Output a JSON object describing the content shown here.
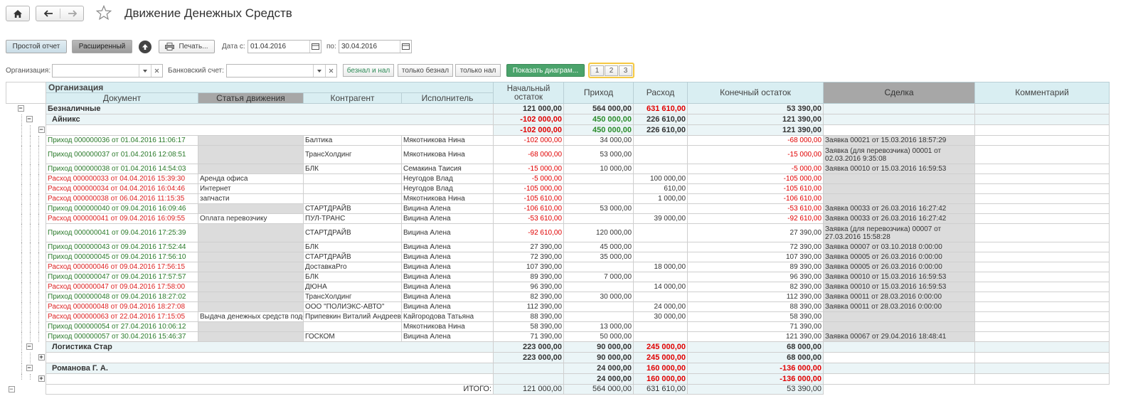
{
  "window": {
    "title": "Движение Денежных Средств"
  },
  "toolbar": {
    "simple_report": "Простой отчет",
    "extended": "Расширенный",
    "print": "Печать...",
    "date_from_label": "Дата с:",
    "date_from": "01.04.2016",
    "date_to_label": "по:",
    "date_to": "30.04.2016"
  },
  "filters": {
    "org_label": "Организация:",
    "org_value": "",
    "bank_label": "Банковский счет:",
    "bank_value": "",
    "payment_modes": [
      "безнал и нал",
      "только безнал",
      "только нал"
    ],
    "show_diagram": "Показать диаграм...",
    "pages": [
      "1",
      "2",
      "3"
    ]
  },
  "report": {
    "headers": {
      "org": "Организация",
      "doc": "Документ",
      "article": "Статья движения",
      "contragent": "Контрагент",
      "executor": "Исполнитель",
      "start": "Начальный остаток",
      "income": "Приход",
      "expense": "Расход",
      "end": "Конечный остаток",
      "deal": "Сделка",
      "comment": "Комментарий"
    },
    "group_beznal": {
      "label": "Безналичные",
      "start": "121 000,00",
      "income": "564 000,00",
      "expense": "631 610,00",
      "end": "53 390,00"
    },
    "org_ainiks": {
      "label": "Айникс",
      "start": "-102 000,00",
      "income": "450 000,00",
      "expense": "226 610,00",
      "end": "121 390,00"
    },
    "sub_ainiks": {
      "start": "-102 000,00",
      "income": "450 000,00",
      "expense": "226 610,00",
      "end": "121 390,00"
    },
    "rows": [
      {
        "doc": "Приход 000000036 от 01.04.2016 11:06:17",
        "article": "",
        "contragent": "Балтика",
        "executor": "Мякотникова Нина",
        "start": "-102 000,00",
        "income": "34 000,00",
        "expense": "",
        "end": "-68 000,00",
        "deal": "Заявка 00021 от 15.03.2016 18:57:29"
      },
      {
        "doc": "Приход 000000037 от 01.04.2016 12:08:51",
        "article": "",
        "contragent": "ТрансХолдинг",
        "executor": "Мякотникова Нина",
        "start": "-68 000,00",
        "income": "53 000,00",
        "expense": "",
        "end": "-15 000,00",
        "deal": "Заявка (для перевозчика) 00001 от 02.03.2016 9:35:08"
      },
      {
        "doc": "Приход 000000038 от 01.04.2016 14:54:03",
        "article": "",
        "contragent": "БЛК",
        "executor": "Семакина Таисия",
        "start": "-15 000,00",
        "income": "10 000,00",
        "expense": "",
        "end": "-5 000,00",
        "deal": "Заявка 00010 от 15.03.2016 16:59:53"
      },
      {
        "doc": "Расход 000000033 от 04.04.2016 15:39:30",
        "article": "Аренда офиса",
        "contragent": "",
        "executor": "Неугодов Влад",
        "start": "-5 000,00",
        "income": "",
        "expense": "100 000,00",
        "end": "-105 000,00",
        "deal": ""
      },
      {
        "doc": "Расход 000000034 от 04.04.2016 16:04:46",
        "article": "Интернет",
        "contragent": "",
        "executor": "Неугодов Влад",
        "start": "-105 000,00",
        "income": "",
        "expense": "610,00",
        "end": "-105 610,00",
        "deal": ""
      },
      {
        "doc": "Расход 000000038 от 06.04.2016 11:15:35",
        "article": "запчасти",
        "contragent": "",
        "executor": "Мякотникова Нина",
        "start": "-105 610,00",
        "income": "",
        "expense": "1 000,00",
        "end": "-106 610,00",
        "deal": ""
      },
      {
        "doc": "Приход 000000040 от 09.04.2016 16:09:46",
        "article": "",
        "contragent": "СТАРТДРАЙВ",
        "executor": "Вицина Алена",
        "start": "-106 610,00",
        "income": "53 000,00",
        "expense": "",
        "end": "-53 610,00",
        "deal": "Заявка 00033 от 26.03.2016 16:27:42"
      },
      {
        "doc": "Расход 000000041 от 09.04.2016 16:09:55",
        "article": "Оплата перевозчику",
        "contragent": "ПУЛ-ТРАНС",
        "executor": "Вицина Алена",
        "start": "-53 610,00",
        "income": "",
        "expense": "39 000,00",
        "end": "-92 610,00",
        "deal": "Заявка 00033 от 26.03.2016 16:27:42"
      },
      {
        "doc": "Приход 000000041 от 09.04.2016 17:25:39",
        "article": "",
        "contragent": "СТАРТДРАЙВ",
        "executor": "Вицина Алена",
        "start": "-92 610,00",
        "income": "120 000,00",
        "expense": "",
        "end": "27 390,00",
        "deal": "Заявка (для перевозчика) 00007 от 27.03.2016 15:58:28"
      },
      {
        "doc": "Приход 000000043 от 09.04.2016 17:52:44",
        "article": "",
        "contragent": "БЛК",
        "executor": "Вицина Алена",
        "start": "27 390,00",
        "income": "45 000,00",
        "expense": "",
        "end": "72 390,00",
        "deal": "Заявка 00007 от 03.10.2018 0:00:00"
      },
      {
        "doc": "Приход 000000045 от 09.04.2016 17:56:10",
        "article": "",
        "contragent": "СТАРТДРАЙВ",
        "executor": "Вицина Алена",
        "start": "72 390,00",
        "income": "35 000,00",
        "expense": "",
        "end": "107 390,00",
        "deal": "Заявка 00005 от 26.03.2016 0:00:00"
      },
      {
        "doc": "Расход 000000046 от 09.04.2016 17:56:15",
        "article": "",
        "contragent": "ДоставкаPro",
        "executor": "Вицина Алена",
        "start": "107 390,00",
        "income": "",
        "expense": "18 000,00",
        "end": "89 390,00",
        "deal": "Заявка 00005 от 26.03.2016 0:00:00"
      },
      {
        "doc": "Приход 000000047 от 09.04.2016 17:57:57",
        "article": "",
        "contragent": "БЛК",
        "executor": "Вицина Алена",
        "start": "89 390,00",
        "income": "7 000,00",
        "expense": "",
        "end": "96 390,00",
        "deal": "Заявка 00010 от 15.03.2016 16:59:53"
      },
      {
        "doc": "Расход 000000047 от 09.04.2016 17:58:00",
        "article": "",
        "contragent": "ДЮНА",
        "executor": "Вицина Алена",
        "start": "96 390,00",
        "income": "",
        "expense": "14 000,00",
        "end": "82 390,00",
        "deal": "Заявка 00010 от 15.03.2016 16:59:53"
      },
      {
        "doc": "Приход 000000048 от 09.04.2016 18:27:02",
        "article": "",
        "contragent": "ТрансХолдинг",
        "executor": "Вицина Алена",
        "start": "82 390,00",
        "income": "30 000,00",
        "expense": "",
        "end": "112 390,00",
        "deal": "Заявка 00011 от 28.03.2016 0:00:00"
      },
      {
        "doc": "Расход 000000048 от 09.04.2016 18:27:08",
        "article": "",
        "contragent": "ООО \"ПОЛИЭКС-АВТО\"",
        "executor": "Вицина Алена",
        "start": "112 390,00",
        "income": "",
        "expense": "24 000,00",
        "end": "88 390,00",
        "deal": "Заявка 00011 от 28.03.2016 0:00:00"
      },
      {
        "doc": "Расход 000000063 от 22.04.2016 17:15:05",
        "article": "Выдача денежных средств подо",
        "contragent": "Припевкин Виталий Андреевич",
        "executor": "Кайгородова Татьяна",
        "start": "88 390,00",
        "income": "",
        "expense": "30 000,00",
        "end": "58 390,00",
        "deal": ""
      },
      {
        "doc": "Приход 000000054 от 27.04.2016 10:06:12",
        "article": "",
        "contragent": "",
        "executor": "Мякотникова Нина",
        "start": "58 390,00",
        "income": "13 000,00",
        "expense": "",
        "end": "71 390,00",
        "deal": ""
      },
      {
        "doc": "Приход 000000057 от 30.04.2016 15:46:37",
        "article": "",
        "contragent": "ГОСКОМ",
        "executor": "Вицина Алена",
        "start": "71 390,00",
        "income": "50 000,00",
        "expense": "",
        "end": "121 390,00",
        "deal": "Заявка 00067 от 29.04.2016 18:48:41"
      }
    ],
    "org_logistika": {
      "label": "Логистика Стар",
      "start": "223 000,00",
      "income": "90 000,00",
      "expense": "245 000,00",
      "end": "68 000,00"
    },
    "sub_logistika": {
      "start": "223 000,00",
      "income": "90 000,00",
      "expense": "245 000,00",
      "end": "68 000,00"
    },
    "org_romanova": {
      "label": "Романова Г. А.",
      "start": "",
      "income": "24 000,00",
      "expense": "160 000,00",
      "end": "-136 000,00"
    },
    "sub_romanova": {
      "start": "",
      "income": "24 000,00",
      "expense": "160 000,00",
      "end": "-136 000,00"
    },
    "total": {
      "label": "ИТОГО:",
      "start": "121 000,00",
      "income": "564 000,00",
      "expense": "631 610,00",
      "end": "53 390,00"
    }
  }
}
